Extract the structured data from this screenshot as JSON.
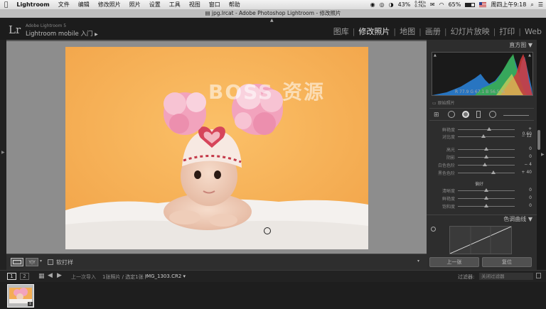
{
  "menubar": {
    "app": "Lightroom",
    "items": [
      "文件",
      "编辑",
      "修改照片",
      "照片",
      "设置",
      "工具",
      "视图",
      "窗口",
      "帮助"
    ],
    "battery": "43%",
    "net_up": "0.4K/s",
    "net_down": "0.7K/s",
    "wifi_battery": "65%",
    "clock": "周四上午9:18"
  },
  "window": {
    "title": "jpg.lrcat - Adobe Photoshop Lightroom - 修改照片"
  },
  "identity": {
    "logo": "Lr",
    "product": "Adobe Lightroom 5",
    "mobile": "Lightroom mobile 入门",
    "modules": [
      "图库",
      "修改照片",
      "地图",
      "画册",
      "幻灯片放映",
      "打印",
      "Web"
    ]
  },
  "watermark": "BOSS 资源",
  "toolbar": {
    "view_compare": "Y|Y",
    "proof_label": "软打样"
  },
  "right_panel": {
    "histogram_title": "直方图",
    "rgb_readout": "R 77.9 G 67.1 B 56.5 %",
    "original_photo": "原始照片",
    "sliders_top": [
      {
        "label": "鲜艳度",
        "value": "+ 0.60",
        "pos": 0.55
      },
      {
        "label": "对比度",
        "value": "− 12",
        "pos": 0.45
      }
    ],
    "sliders_mid": [
      {
        "label": "高光",
        "value": "0",
        "pos": 0.5
      },
      {
        "label": "阴影",
        "value": "0",
        "pos": 0.5
      },
      {
        "label": "白色色阶",
        "value": "− 4",
        "pos": 0.48
      },
      {
        "label": "黑色色阶",
        "value": "+ 40",
        "pos": 0.62
      }
    ],
    "presence_title": "偏好",
    "sliders_presence": [
      {
        "label": "清晰度",
        "value": "0",
        "pos": 0.5
      },
      {
        "label": "鲜艳度",
        "value": "0",
        "pos": 0.5
      },
      {
        "label": "饱和度",
        "value": "0",
        "pos": 0.5
      }
    ],
    "tone_curve_title": "色调曲线",
    "prev_button": "上一张",
    "reset_button": "复位"
  },
  "filmbar": {
    "page1": "1",
    "page2": "2",
    "source": "上一次导入",
    "count": "1张照片 / 选定1张 /",
    "filename": "IMG_1303.CR2",
    "filter_label": "过滤器:",
    "filter_value": "关闭过滤器"
  },
  "colors": {
    "accent": "#e8e8e8",
    "panel": "#2d2d2d",
    "canvas": "#8d8d8d"
  }
}
